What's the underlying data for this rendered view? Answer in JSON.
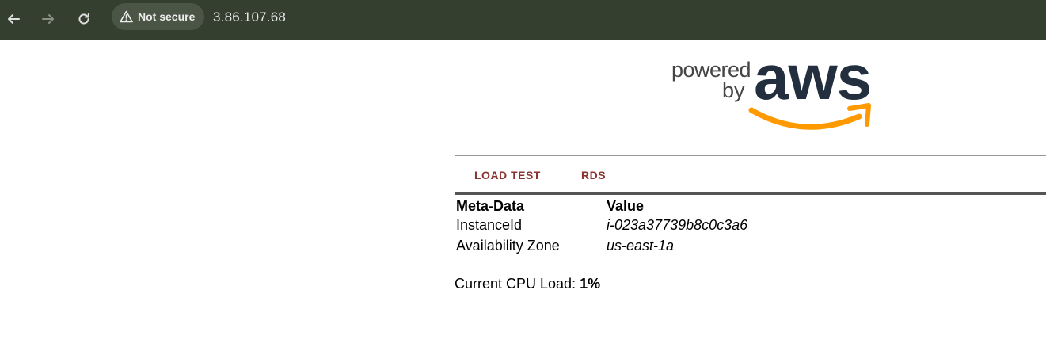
{
  "browser": {
    "back_icon": "arrow-left-icon",
    "forward_icon": "arrow-right-icon",
    "reload_icon": "reload-icon",
    "security_icon": "warning-triangle-icon",
    "security_label": "Not secure",
    "url": "3.86.107.68",
    "bar_color": "#343f30"
  },
  "logo": {
    "powered": "powered",
    "by": "by",
    "aws": "aws",
    "brand_dark": "#232f3e",
    "brand_orange": "#ff9900"
  },
  "tabs": [
    {
      "label": "LOAD TEST"
    },
    {
      "label": "RDS"
    }
  ],
  "tab_color": "#8a3430",
  "meta_table": {
    "headers": [
      "Meta-Data",
      "Value"
    ],
    "rows": [
      [
        "InstanceId",
        "i-023a37739b8c0c3a6"
      ],
      [
        "Availability Zone",
        "us-east-1a"
      ]
    ]
  },
  "cpu": {
    "label": "Current CPU Load:",
    "value": "1%"
  }
}
